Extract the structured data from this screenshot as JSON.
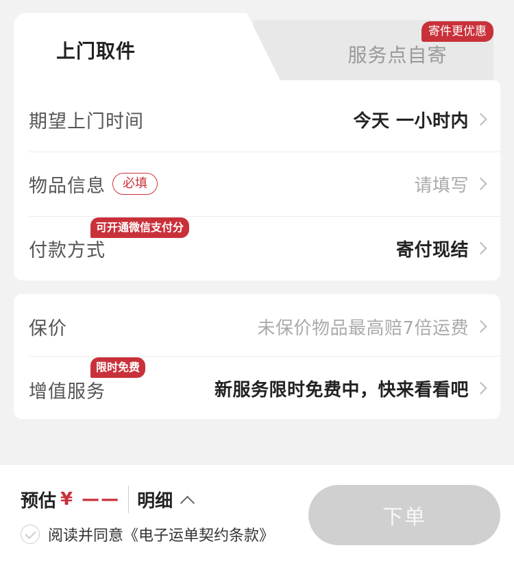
{
  "tabs": {
    "active_label": "上门取件",
    "inactive_label": "服务点自寄",
    "inactive_badge": "寄件更优惠"
  },
  "pickup_card": {
    "time": {
      "label": "期望上门时间",
      "value": "今天 一小时内"
    },
    "item": {
      "label": "物品信息",
      "required_tag": "必填",
      "value": "请填写"
    },
    "payment": {
      "label": "付款方式",
      "promo_tag": "可开通微信支付分",
      "value": "寄付现结"
    }
  },
  "service_card": {
    "insurance": {
      "label": "保价",
      "value": "未保价物品最高赔7倍运费"
    },
    "value_added": {
      "label": "增值服务",
      "promo_tag": "限时免费",
      "value": "新服务限时免费中，快来看看吧"
    }
  },
  "bottom_bar": {
    "estimate_label": "预估",
    "price": "¥ ——",
    "detail_label": "明细",
    "agreement_text": "阅读并同意《电子运单契约条款》",
    "order_button": "下单"
  },
  "colors": {
    "accent_red": "#c9313a",
    "disabled_button": "#d0d0d0",
    "page_background": "#f2f2f2"
  },
  "icons": [
    "chevron-right-icon",
    "chevron-up-icon",
    "check-circle-icon"
  ]
}
